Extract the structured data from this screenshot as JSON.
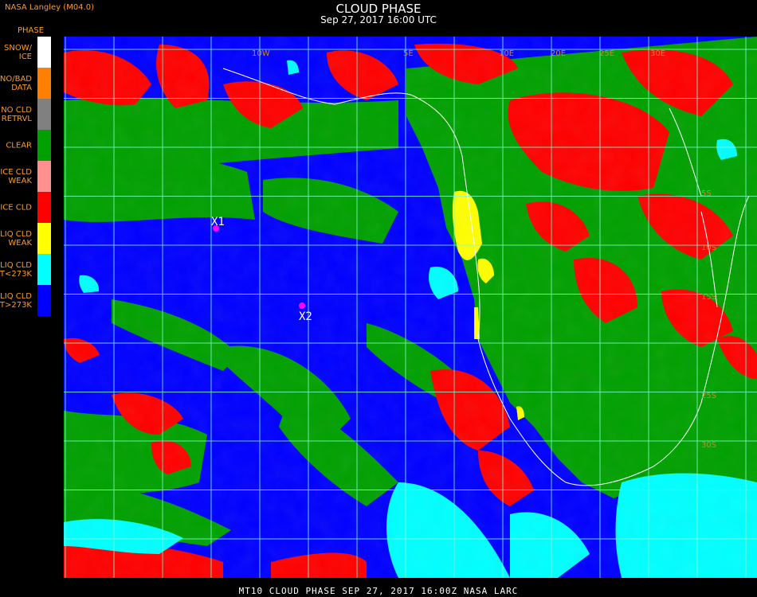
{
  "header": {
    "source": "NASA Langley (M04.0)",
    "param": "PHASE",
    "title": "CLOUD PHASE",
    "subtitle": "Sep 27, 2017 16:00 UTC"
  },
  "legend": [
    {
      "label": "SNOW/\nICE",
      "color": "#ffffff"
    },
    {
      "label": "NO/BAD\nDATA",
      "color": "#ff8000"
    },
    {
      "label": "NO CLD\nRETRVL",
      "color": "#808080"
    },
    {
      "label": "CLEAR",
      "color": "#00a000"
    },
    {
      "label": "ICE CLD\nWEAK",
      "color": "#ff9090"
    },
    {
      "label": "ICE CLD",
      "color": "#ff0000"
    },
    {
      "label": "LIQ CLD\nWEAK",
      "color": "#ffff00"
    },
    {
      "label": "LIQ CLD\nT<273K",
      "color": "#00ffff"
    },
    {
      "label": "LIQ CLD\nT>273K",
      "color": "#0000ff"
    }
  ],
  "markers": [
    {
      "label": "X1"
    },
    {
      "label": "X2"
    }
  ],
  "grid_labels": [
    "10W",
    "5E",
    "10E",
    "20E",
    "25E",
    "30E",
    "5S",
    "10S",
    "15S",
    "25S",
    "30S"
  ],
  "footer": "MT10   CLOUD PHASE   SEP 27, 2017 16:00Z   NASA LARC"
}
